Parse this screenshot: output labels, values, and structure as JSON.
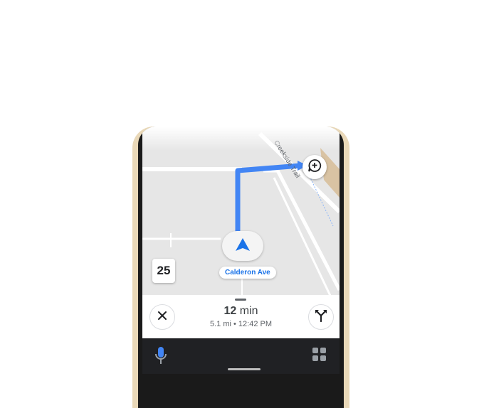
{
  "map": {
    "street_label": "Calderon Ave",
    "road_label": "Creekside Trail",
    "route_color": "#4285f4"
  },
  "speed_limit": "25",
  "trip": {
    "minutes": "12",
    "minutes_unit": "min",
    "distance": "5.1 mi",
    "separator": "•",
    "arrival": "12:42 PM"
  },
  "icons": {
    "report": "report-incident-icon",
    "navigation": "navigation-arrow-icon",
    "close": "close-icon",
    "alternate_routes": "alternate-routes-icon",
    "mic": "microphone-icon",
    "apps": "app-grid-icon"
  }
}
